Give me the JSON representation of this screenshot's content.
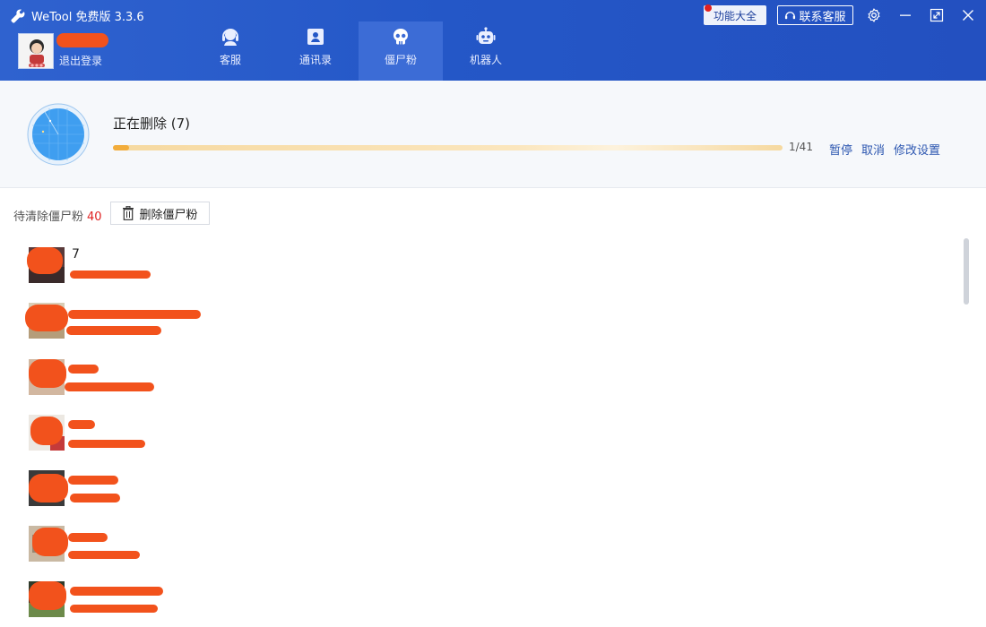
{
  "app": {
    "title": "WeTool 免费版 3.3.6",
    "logout_label": "退出登录"
  },
  "nav": {
    "tabs": [
      {
        "label": "客服",
        "icon": "headset-icon"
      },
      {
        "label": "通讯录",
        "icon": "contact-card-icon"
      },
      {
        "label": "僵尸粉",
        "icon": "skull-icon"
      },
      {
        "label": "机器人",
        "icon": "robot-icon"
      }
    ],
    "active_tab": "僵尸粉"
  },
  "toolbar": {
    "features_label": "功能大全",
    "support_label": "联系客服"
  },
  "progress": {
    "title": "正在删除 (7)",
    "count_text": "1/41",
    "fraction": 0.024,
    "pause_label": "暂停",
    "cancel_label": "取消",
    "settings_label": "修改设置"
  },
  "pending": {
    "label": "待清除僵尸粉",
    "count": "40",
    "delete_button": "删除僵尸粉"
  },
  "list": {
    "items": [
      {
        "name": "7"
      },
      {
        "name": ""
      },
      {
        "name": ""
      },
      {
        "name": ""
      },
      {
        "name": ""
      },
      {
        "name": ""
      },
      {
        "name": ""
      }
    ]
  },
  "colors": {
    "header": "#2457c7",
    "accent": "#2c56b0",
    "progress_fill": "#f2ad3c",
    "redaction": "#f2521c",
    "count_red": "#e02020"
  }
}
